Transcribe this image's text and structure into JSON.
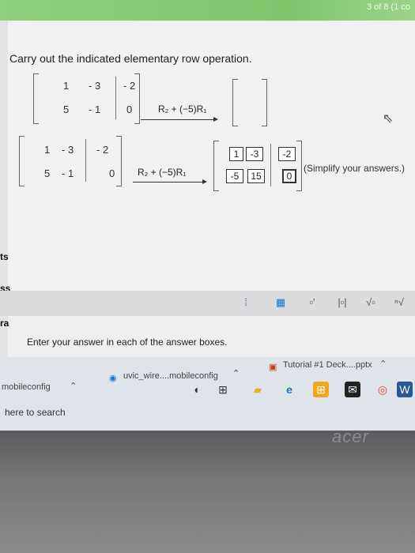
{
  "topbar": {
    "text": "3 of 8 (1 co"
  },
  "question": {
    "prompt": "Carry out the indicated elementary row operation.",
    "left_matrix": {
      "row1": [
        "1",
        "- 3",
        "- 2"
      ],
      "row2": [
        "5",
        "- 1",
        "0"
      ]
    },
    "operation": "R₂ + (−5)R₁"
  },
  "answer": {
    "left_matrix": {
      "row1": [
        "1",
        "- 3",
        "- 2"
      ],
      "row2": [
        "5",
        "- 1",
        "0"
      ]
    },
    "operation": "R₂ + (−5)R₁",
    "result_row1": [
      "1",
      "-3",
      "-2"
    ],
    "result_row2": [
      "-5",
      "15",
      "0"
    ],
    "hint": "(Simplify your answers.)"
  },
  "side_labels": {
    "points": "ts",
    "progress": "ss",
    "program": "ral"
  },
  "answer_area": {
    "instruction": "Enter your answer in each of the answer boxes."
  },
  "downloads": {
    "item1": "mobileconfig",
    "item2": "uvic_wire....mobileconfig",
    "item3": "Tutorial #1 Deck....pptx"
  },
  "taskbar": {
    "search": "here to search"
  },
  "bezel": {
    "brand": "acer"
  },
  "colors": {
    "accent_blue": "#1a73c9",
    "topbar_green": "#8dcf7a"
  },
  "icons": [
    "fraction-icon",
    "matrix-icon",
    "superscript-icon",
    "abs-icon",
    "sqrt-icon",
    "nth-root-icon"
  ]
}
